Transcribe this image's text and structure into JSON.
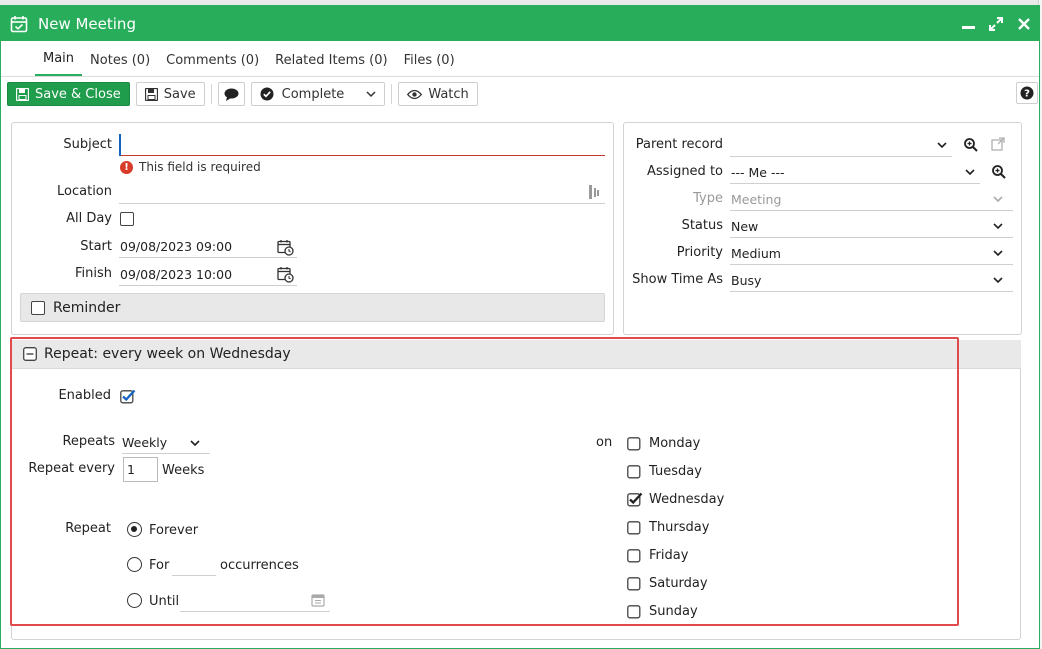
{
  "window": {
    "title": "New Meeting"
  },
  "tabs": [
    "Main",
    "Notes (0)",
    "Comments (0)",
    "Related Items (0)",
    "Files (0)"
  ],
  "toolbar": {
    "save_close": "Save & Close",
    "save": "Save",
    "complete": "Complete",
    "watch": "Watch"
  },
  "left": {
    "subject_label": "Subject",
    "subject_value": "",
    "subject_error": "This field is required",
    "location_label": "Location",
    "location_value": "",
    "allday_label": "All Day",
    "start_label": "Start",
    "start_value": "09/08/2023 09:00",
    "finish_label": "Finish",
    "finish_value": "09/08/2023 10:00",
    "reminder_label": "Reminder"
  },
  "right": {
    "parent_label": "Parent record",
    "parent_value": "",
    "assigned_label": "Assigned to",
    "assigned_value": "--- Me ---",
    "type_label": "Type",
    "type_value": "Meeting",
    "status_label": "Status",
    "status_value": "New",
    "priority_label": "Priority",
    "priority_value": "Medium",
    "showtime_label": "Show Time As",
    "showtime_value": "Busy"
  },
  "repeat": {
    "header": "Repeat: every week on Wednesday",
    "enabled_label": "Enabled",
    "enabled": true,
    "repeats_label": "Repeats",
    "repeats_value": "Weekly",
    "every_label": "Repeat every",
    "every_value": "1",
    "every_unit": "Weeks",
    "repeat_label": "Repeat",
    "forever_label": "Forever",
    "for_label": "For",
    "occurrences_label": "occurrences",
    "until_label": "Until",
    "on_label": "on",
    "days": [
      {
        "name": "Monday",
        "checked": false
      },
      {
        "name": "Tuesday",
        "checked": false
      },
      {
        "name": "Wednesday",
        "checked": true
      },
      {
        "name": "Thursday",
        "checked": false
      },
      {
        "name": "Friday",
        "checked": false
      },
      {
        "name": "Saturday",
        "checked": false
      },
      {
        "name": "Sunday",
        "checked": false
      }
    ]
  },
  "colors": {
    "brand_green": "#28ae5b",
    "highlight_red": "#e04a4a",
    "check_blue": "#1565c0"
  }
}
